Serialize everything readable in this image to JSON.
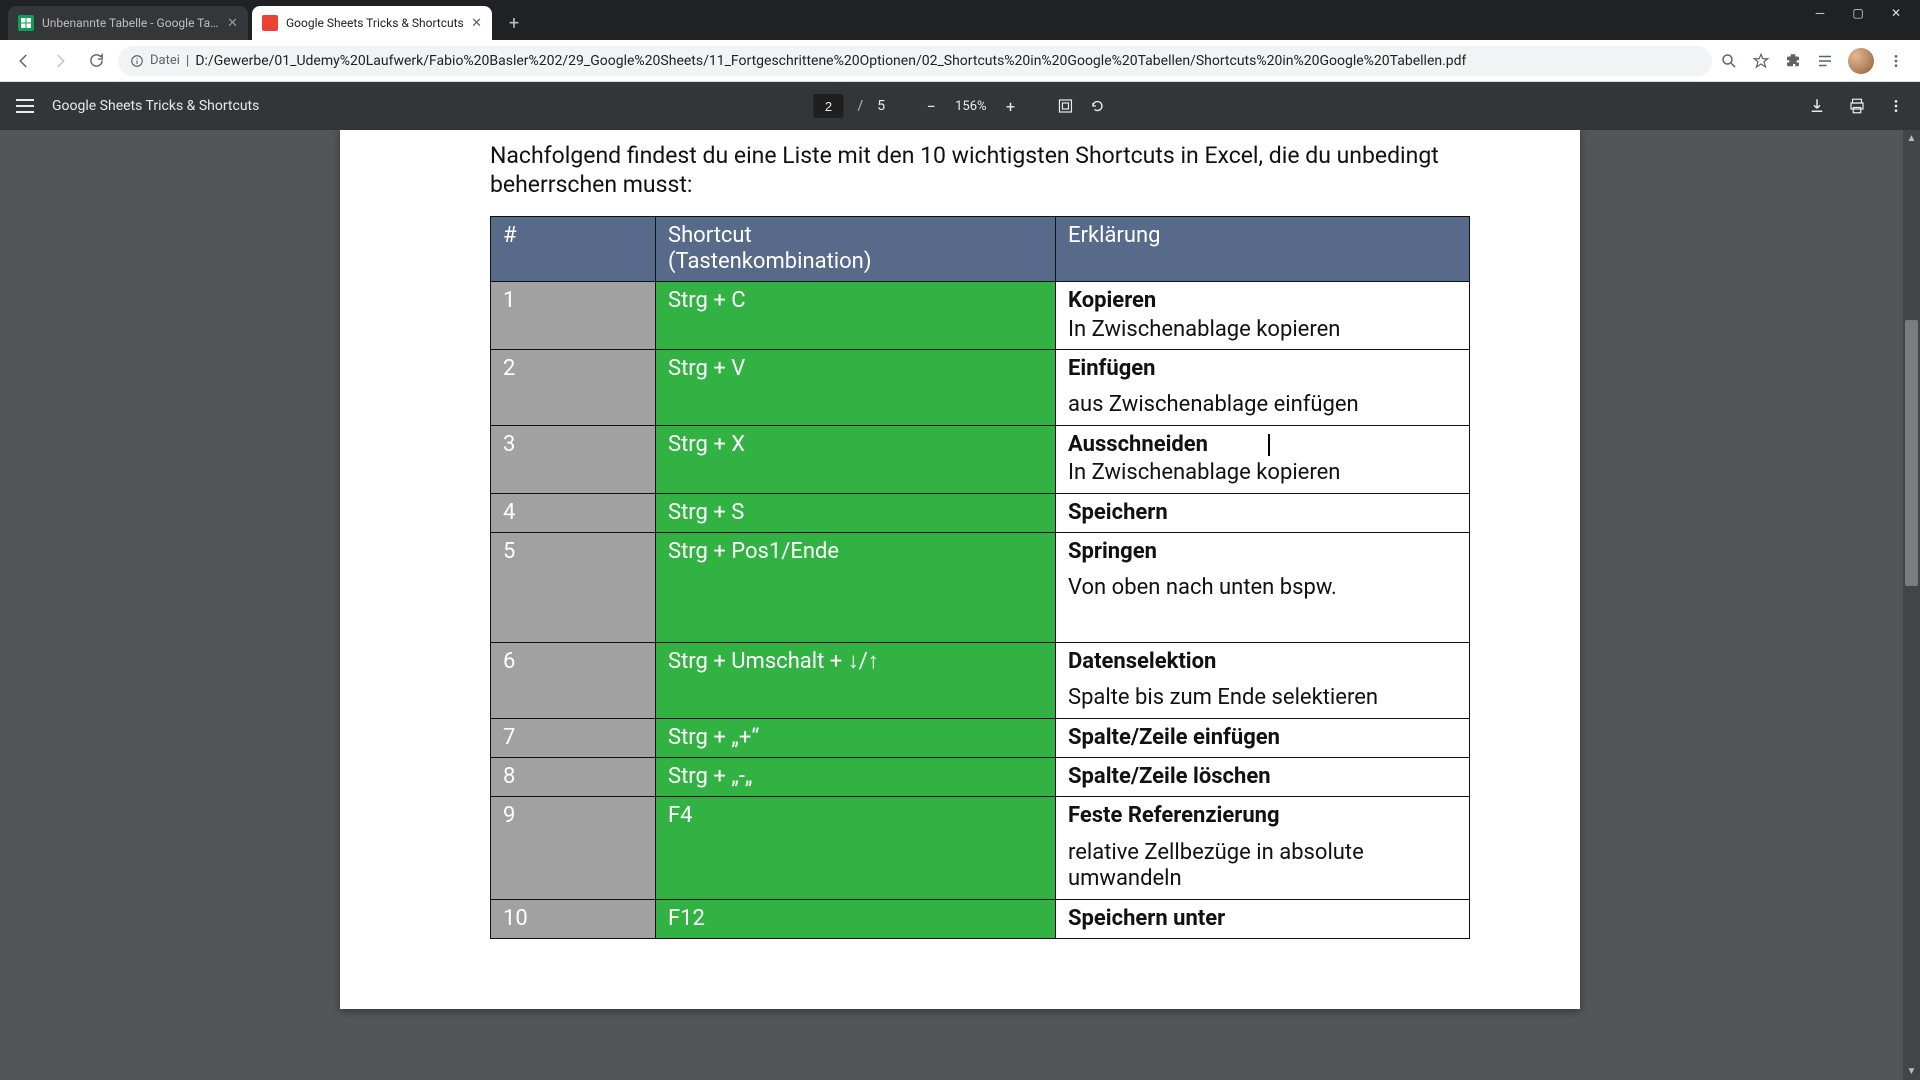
{
  "browser": {
    "tabs": [
      {
        "title": "Unbenannte Tabelle - Google Tabellen"
      },
      {
        "title": "Google Sheets Tricks & Shortcuts"
      }
    ],
    "url_scheme": "Datei",
    "url_path": "D:/Gewerbe/01_Udemy%20Laufwerk/Fabio%20Basler%202/29_Google%20Sheets/11_Fortgeschrittene%20Optionen/02_Shortcuts%20in%20Google%20Tabellen/Shortcuts%20in%20Google%20Tabellen.pdf"
  },
  "pdf": {
    "title": "Google Sheets Tricks & Shortcuts",
    "page_current": "2",
    "page_total": "5",
    "zoom": "156%"
  },
  "content": {
    "intro": "Nachfolgend findest du eine Liste mit den 10 wichtigsten Shortcuts in Excel, die du unbedingt beherrschen musst:",
    "headers": {
      "num": "#",
      "shortcut_l1": "Shortcut",
      "shortcut_l2": "(Tastenkombination)",
      "explain": "Erklärung"
    },
    "rows": [
      {
        "num": "1",
        "shortcut": "Strg + C",
        "title": "Kopieren",
        "sub": "In Zwischenablage kopieren",
        "gap": false
      },
      {
        "num": "2",
        "shortcut": "Strg + V",
        "title": "Einfügen",
        "sub": "aus Zwischenablage einfügen",
        "gap": true
      },
      {
        "num": "3",
        "shortcut": "Strg + X",
        "title": "Ausschneiden",
        "sub": "In Zwischenablage kopieren",
        "gap": false,
        "caret": true
      },
      {
        "num": "4",
        "shortcut": "Strg + S",
        "title": "Speichern",
        "sub": "",
        "gap": false
      },
      {
        "num": "5",
        "shortcut": "Strg + Pos1/Ende",
        "title": "Springen",
        "sub": "Von oben nach unten bspw.",
        "gap": true,
        "tall": true
      },
      {
        "num": "6",
        "shortcut": "Strg + Umschalt + ↓/↑",
        "title": "Datenselektion",
        "sub": "Spalte bis zum Ende selektieren",
        "gap": true
      },
      {
        "num": "7",
        "shortcut": "Strg + „+“",
        "title": "Spalte/Zeile einfügen",
        "sub": "",
        "gap": false
      },
      {
        "num": "8",
        "shortcut": "Strg + „-„",
        "title": "Spalte/Zeile löschen",
        "sub": "",
        "gap": false
      },
      {
        "num": "9",
        "shortcut": "F4",
        "title": "Feste Referenzierung",
        "sub": "relative Zellbezüge in absolute umwandeln",
        "gap": true
      },
      {
        "num": "10",
        "shortcut": "F12",
        "title": "Speichern unter",
        "sub": "",
        "gap": false
      }
    ]
  }
}
